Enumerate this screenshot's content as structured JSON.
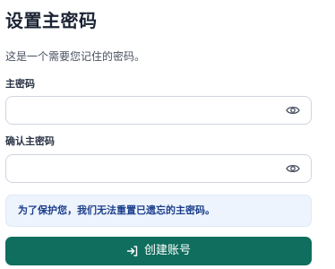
{
  "header": {
    "title": "设置主密码",
    "subtitle": "这是一个需要您记住的密码。"
  },
  "form": {
    "master_password": {
      "label": "主密码",
      "value": "",
      "placeholder": ""
    },
    "confirm_password": {
      "label": "确认主密码",
      "value": "",
      "placeholder": ""
    },
    "visibility_icon": "eye-icon"
  },
  "notice": {
    "text": "为了保护您，我们无法重置已遗忘的主密码。",
    "color": "#1c3f8c",
    "background": "#eef4fd"
  },
  "submit": {
    "label": "创建账号",
    "icon": "login-arrow-icon",
    "color": "#0f6e5e"
  }
}
